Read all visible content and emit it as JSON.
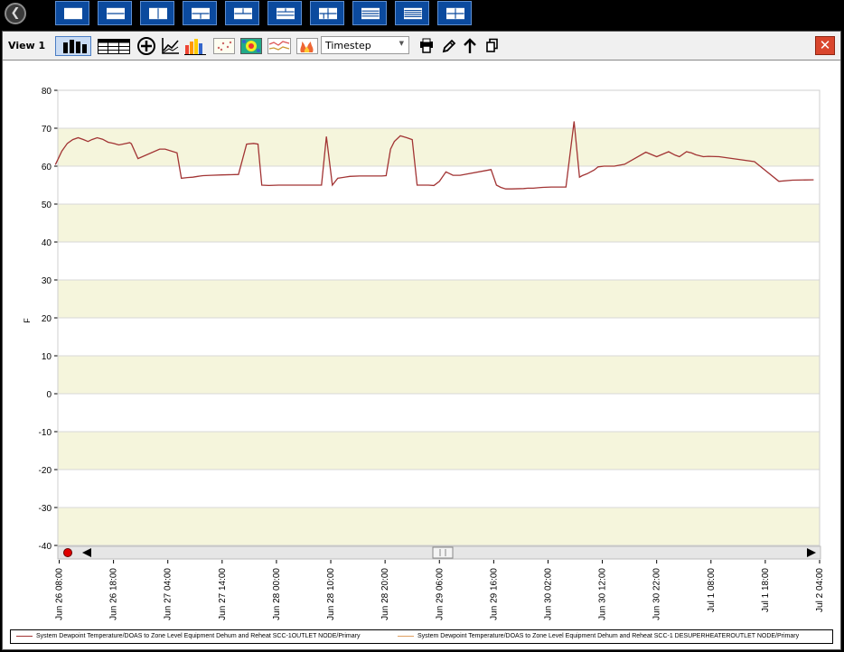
{
  "topbar": {
    "layout_buttons": [
      "layout-single",
      "layout-two-rows",
      "layout-two-columns",
      "layout-one-top-two-bottom",
      "layout-two-top-one-bottom",
      "layout-three-rows-split",
      "layout-two-by-two-split",
      "layout-four-rows",
      "layout-five-rows",
      "layout-two-by-two"
    ]
  },
  "toolbar": {
    "view_title": "View 1",
    "timestep_select": "Timestep",
    "icons": [
      "bar-chart-icon",
      "table-icon",
      "add-icon",
      "line-plot-icon",
      "color-bar-icon",
      "scatter-icon",
      "heatmap-icon",
      "line-compare-icon",
      "fire-icon",
      "printer-icon",
      "pencil-icon",
      "arrow-up-icon",
      "copy-icon",
      "close-icon"
    ]
  },
  "colors": {
    "series_primary": "#a23434",
    "series_secondary": "#e0a060",
    "band_fill": "#f5f5dc",
    "close_button": "#d9462d",
    "layout_button": "#0b4a9e"
  },
  "chart_data": {
    "type": "line",
    "ylabel": "F",
    "ylim": [
      -40,
      80
    ],
    "yticks": [
      "80",
      "70",
      "60",
      "50",
      "40",
      "30",
      "20",
      "10",
      "0",
      "-10",
      "-20",
      "-30",
      "-40"
    ],
    "xticks": [
      "Jun 26 08:00",
      "Jun 26 18:00",
      "Jun 27 04:00",
      "Jun 27 14:00",
      "Jun 28 00:00",
      "Jun 28 10:00",
      "Jun 28 20:00",
      "Jun 29 06:00",
      "Jun 29 16:00",
      "Jun 30 02:00",
      "Jun 30 12:00",
      "Jun 30 22:00",
      "Jul 1 08:00",
      "Jul 1 18:00",
      "Jul 2 04:00"
    ],
    "x_hours": [
      -0.7,
      0.5,
      1.5,
      2.5,
      3.5,
      4.5,
      5.3,
      6,
      7,
      8,
      9,
      10,
      11,
      12,
      13,
      13.3,
      14.5,
      18.5,
      19.5,
      21.7,
      22.5,
      23.6,
      24.6,
      25.5,
      26,
      26.5,
      28,
      30,
      33,
      34.5,
      35.8,
      36.6,
      37.3,
      38.6,
      40.4,
      40.9,
      41.8,
      42.7,
      43.6,
      44.6,
      45.5,
      46.5,
      47.4,
      48.3,
      49.2,
      50.3,
      51.3,
      53.5,
      55.3,
      57.4,
      59.4,
      60.2,
      61,
      61.7,
      62.8,
      64,
      65,
      65.9,
      67,
      68,
      69,
      70,
      71.2,
      72.5,
      73.8,
      79.5,
      80.5,
      81.3,
      82.2,
      83.3,
      85.5,
      86.3,
      87.3,
      88.2,
      89,
      90.6,
      92.3,
      93.3,
      94.8,
      95.8,
      96.3,
      97.2,
      98.5,
      99.2,
      100.3,
      102.2,
      104.1,
      108,
      110,
      111,
      112.2,
      113.4,
      114.2,
      115.5,
      116.4,
      117.2,
      118.6,
      119.5,
      121.5,
      128,
      132.5,
      135,
      138.9
    ],
    "series": [
      {
        "values": [
          60.4,
          64,
          66,
          67,
          67.5,
          67,
          66.5,
          67,
          67.5,
          67.1,
          66.3,
          66,
          65.6,
          65.9,
          66.2,
          65.9,
          62,
          64.5,
          64.5,
          63.5,
          56.8,
          57,
          57.1,
          57.3,
          57.4,
          57.5,
          57.6,
          57.7,
          57.8,
          65.8,
          66,
          65.8,
          55,
          54.9,
          55,
          55,
          55,
          55,
          55,
          55,
          55,
          55,
          55,
          55,
          67.8,
          55,
          56.8,
          57.3,
          57.4,
          57.4,
          57.4,
          57.5,
          64.5,
          66.5,
          68,
          67.5,
          67,
          55,
          55,
          55,
          54.9,
          56,
          58.5,
          57.6,
          57.6,
          59.1,
          55,
          54.4,
          54,
          54,
          54.1,
          54.2,
          54.2,
          54.3,
          54.4,
          54.5,
          54.5,
          54.5,
          71.8,
          57.1,
          57.5,
          58,
          59,
          59.8,
          60,
          60,
          60.5,
          63.7,
          62.5,
          63.1,
          63.8,
          62.9,
          62.5,
          63.8,
          63.5,
          63,
          62.5,
          62.6,
          62.5,
          61.2,
          56,
          56.3,
          56.4
        ],
        "color": "#a23434"
      }
    ],
    "legend": [
      {
        "label": "System Dewpoint Temperature/DOAS to Zone Level Equipment Dehum and Reheat SCC-1OUTLET NODE/Primary",
        "color": "#a23434"
      },
      {
        "label": "System Dewpoint Temperature/DOAS to Zone Level Equipment Dehum and Reheat SCC-1 DESUPERHEATEROUTLET NODE/Primary",
        "color": "#e0a060"
      }
    ]
  }
}
